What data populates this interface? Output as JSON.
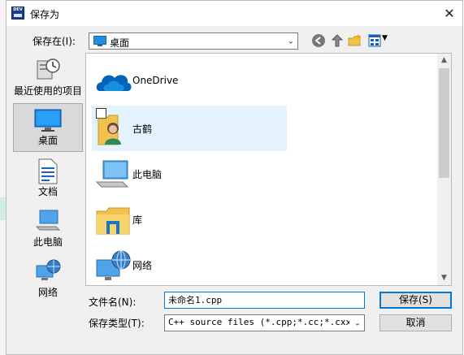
{
  "window": {
    "title": "保存为",
    "close": "✕"
  },
  "app_icon_text": "DEV",
  "lookin": {
    "label": "保存在(I):",
    "value": "桌面"
  },
  "places": [
    {
      "name": "recent",
      "label": "最近使用的项目"
    },
    {
      "name": "desktop",
      "label": "桌面",
      "selected": true
    },
    {
      "name": "documents",
      "label": "文档"
    },
    {
      "name": "this-pc",
      "label": "此电脑"
    },
    {
      "name": "network",
      "label": "网络"
    }
  ],
  "files": [
    {
      "name": "OneDrive",
      "icon": "onedrive-icon"
    },
    {
      "name": "古鹤",
      "icon": "user-folder-icon",
      "selected": true
    },
    {
      "name": "此电脑",
      "icon": "computer-icon"
    },
    {
      "name": "库",
      "icon": "library-folder-icon"
    },
    {
      "name": "网络",
      "icon": "network-icon"
    }
  ],
  "filename": {
    "label": "文件名(N):",
    "value": "未命名1.cpp"
  },
  "filetype": {
    "label": "保存类型(T):",
    "value": "C++ source files (*.cpp;*.cc;*.cxx;*."
  },
  "buttons": {
    "save": "保存(S)",
    "cancel": "取消"
  },
  "colors": {
    "accent": "#0078d7",
    "selection": "#e5f3ff"
  }
}
